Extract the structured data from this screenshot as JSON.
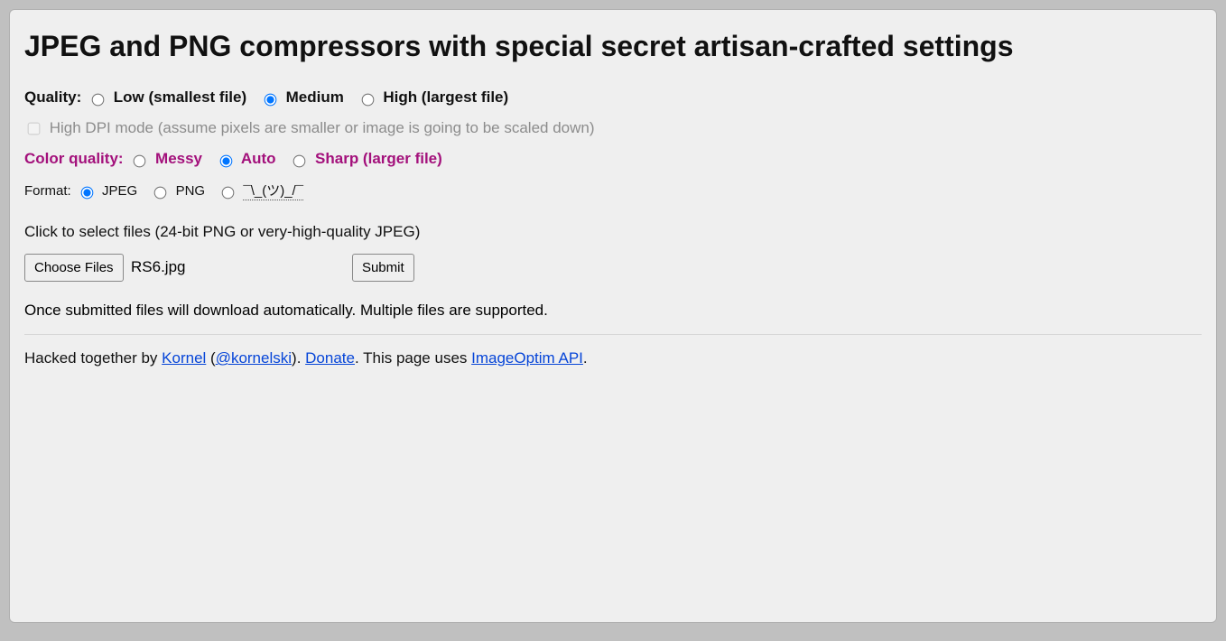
{
  "title": "JPEG and PNG compressors with special secret artisan-crafted settings",
  "quality": {
    "label": "Quality:",
    "low": "Low (smallest file)",
    "medium": "Medium",
    "high": "High (largest file)",
    "selected": "medium"
  },
  "hidpi": {
    "label": "High DPI mode (assume pixels are smaller or image is going to be scaled down)",
    "checked": false,
    "disabled": true
  },
  "color_quality": {
    "label": "Color quality:",
    "messy": "Messy",
    "auto": "Auto",
    "sharp": "Sharp (larger file)",
    "selected": "auto"
  },
  "format": {
    "label": "Format:",
    "jpeg": "JPEG",
    "png": "PNG",
    "shrug": "¯\\_(ツ)_/¯",
    "selected": "jpeg"
  },
  "instructions": "Click to select files (24-bit PNG or very-high-quality JPEG)",
  "choose_files_label": "Choose Files",
  "selected_file": "RS6.jpg",
  "submit_label": "Submit",
  "after_note": "Once submitted files will download automatically. Multiple files are supported.",
  "footer": {
    "pre": "Hacked together by ",
    "author": "Kornel",
    "paren_open": " (",
    "handle": "@kornelski",
    "paren_close": "). ",
    "donate": "Donate",
    "post_donate": ". This page uses ",
    "api": "ImageOptim API",
    "end": "."
  }
}
